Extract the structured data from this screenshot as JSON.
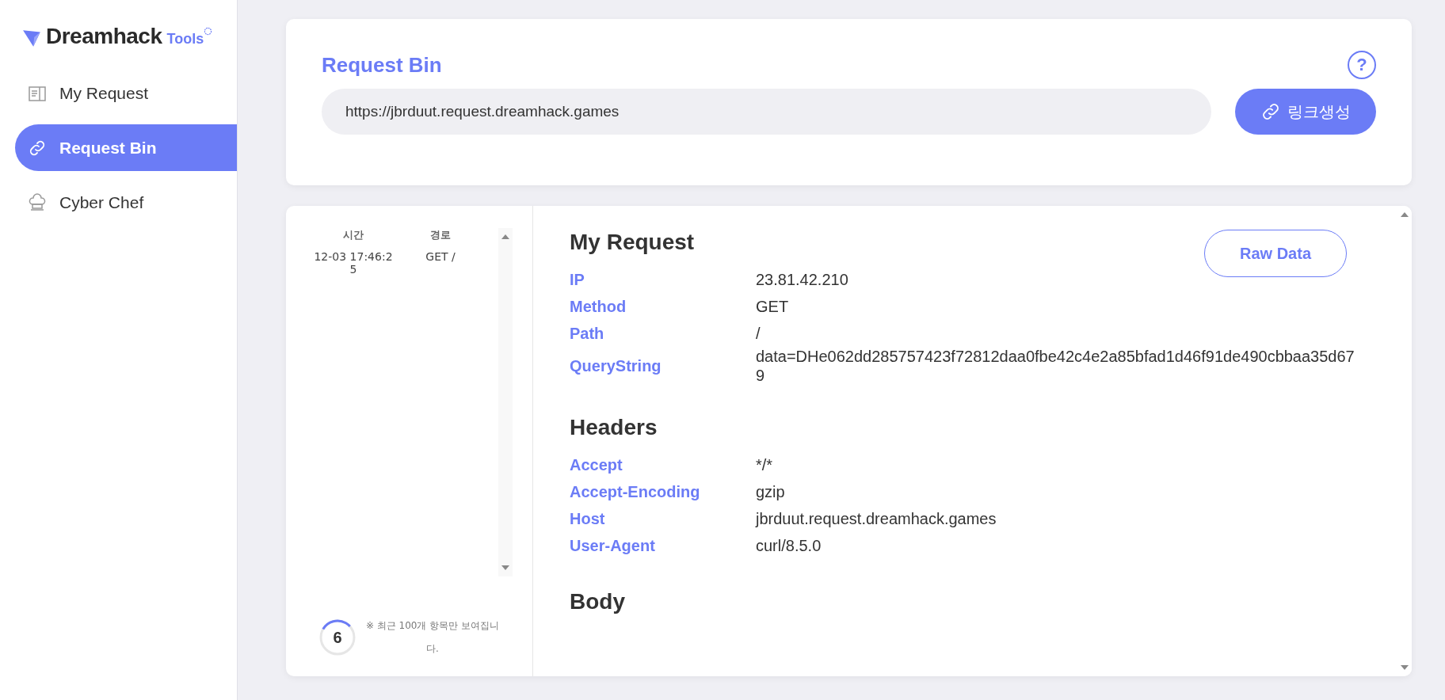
{
  "logo": {
    "name": "Dreamhack",
    "suffix": "Tools"
  },
  "sidebar": {
    "items": [
      {
        "label": "My Request",
        "selected": false
      },
      {
        "label": "Request Bin",
        "selected": true
      },
      {
        "label": "Cyber Chef",
        "selected": false
      }
    ]
  },
  "bin": {
    "title": "Request Bin",
    "help": "?",
    "url": "https://jbrduut.request.dreamhack.games",
    "button": "링크생성"
  },
  "list": {
    "columns": [
      "시간",
      "경로"
    ],
    "rows": [
      {
        "time": "12-03 17:46:25",
        "path": "GET /",
        "selected": false
      }
    ],
    "counter": {
      "value": "6",
      "level": 0.3
    },
    "note": "※ 최근 100개 항목만 보여집니다."
  },
  "detail": {
    "raw_button": "Raw Data",
    "sections": [
      {
        "title": "My Request",
        "fields": [
          {
            "key": "IP",
            "value": "23.81.42.210"
          },
          {
            "key": "Method",
            "value": "GET"
          },
          {
            "key": "Path",
            "value": "/"
          },
          {
            "key": "QueryString",
            "value": "data=DHe062dd285757423f72812daa0fbe42c4e2a85bfad1d46f91de490cbbaa35d679"
          }
        ]
      },
      {
        "title": "Headers",
        "fields": [
          {
            "key": "Accept",
            "value": "*/*"
          },
          {
            "key": "Accept-Encoding",
            "value": "gzip"
          },
          {
            "key": "Host",
            "value": "jbrduut.request.dreamhack.games"
          },
          {
            "key": "User-Agent",
            "value": "curl/8.5.0"
          }
        ]
      },
      {
        "title": "Body"
      }
    ]
  }
}
